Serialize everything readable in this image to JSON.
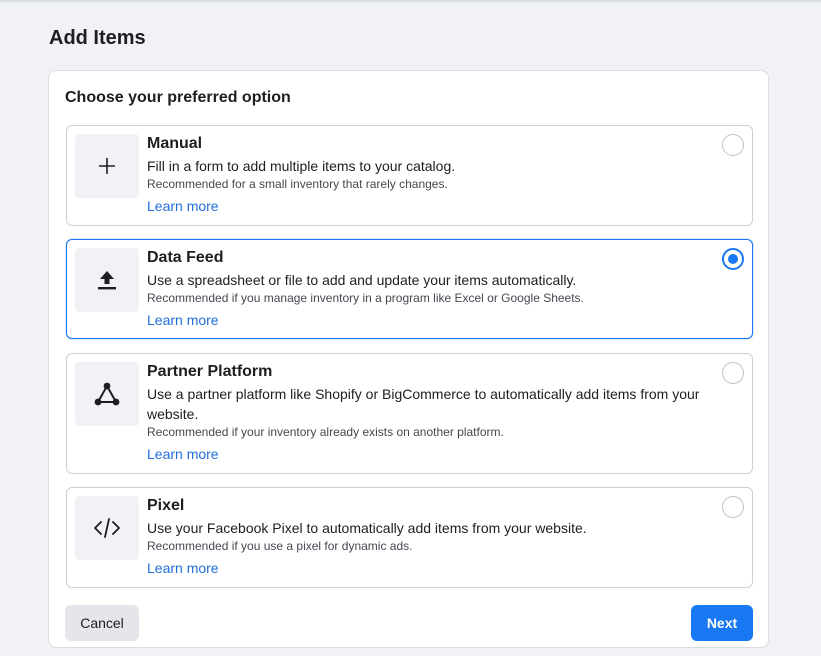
{
  "page": {
    "title": "Add Items"
  },
  "card": {
    "heading": "Choose your preferred option"
  },
  "options": [
    {
      "id": "manual",
      "title": "Manual",
      "description": "Fill in a form to add multiple items to your catalog.",
      "recommendation": "Recommended for a small inventory that rarely changes.",
      "link": "Learn more",
      "icon": "plus-icon",
      "selected": false
    },
    {
      "id": "data-feed",
      "title": "Data Feed",
      "description": "Use a spreadsheet or file to add and update your items automatically.",
      "recommendation": "Recommended if you manage inventory in a program like Excel or Google Sheets.",
      "link": "Learn more",
      "icon": "upload-icon",
      "selected": true
    },
    {
      "id": "partner-platform",
      "title": "Partner Platform",
      "description": "Use a partner platform like Shopify or BigCommerce to automatically add items from your website.",
      "recommendation": "Recommended if your inventory already exists on another platform.",
      "link": "Learn more",
      "icon": "network-icon",
      "selected": false
    },
    {
      "id": "pixel",
      "title": "Pixel",
      "description": "Use your Facebook Pixel to automatically add items from your website.",
      "recommendation": "Recommended if you use a pixel for dynamic ads.",
      "link": "Learn more",
      "icon": "code-icon",
      "selected": false
    }
  ],
  "actions": {
    "cancel_label": "Cancel",
    "next_label": "Next"
  },
  "colors": {
    "accent": "#1877f2",
    "link": "#216fdb",
    "background": "#f0f2f5"
  }
}
